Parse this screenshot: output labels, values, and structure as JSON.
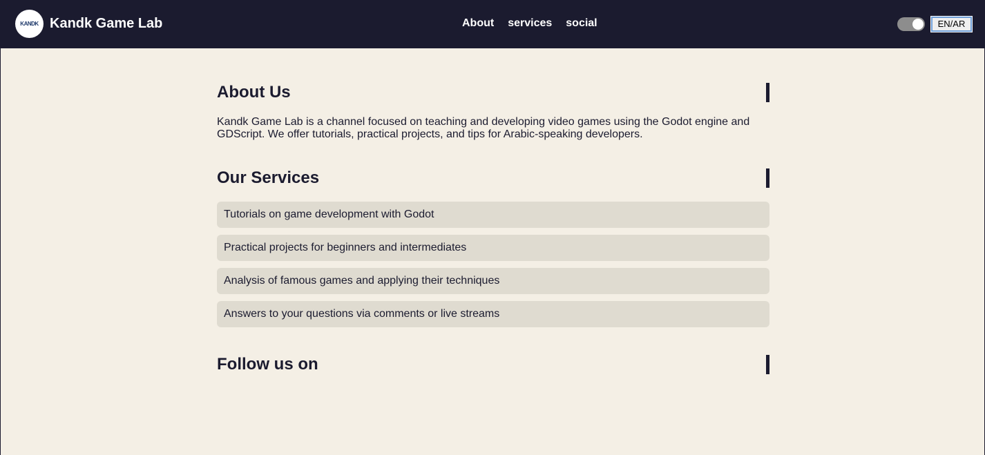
{
  "header": {
    "logo_text": "KANDK",
    "brand": "Kandk Game Lab",
    "nav": [
      "About",
      "services",
      "social"
    ],
    "lang_button": "EN/AR"
  },
  "about": {
    "title": "About Us",
    "text": "Kandk Game Lab is a channel focused on teaching and developing video games using the Godot engine and GDScript. We offer tutorials, practical projects, and tips for Arabic-speaking developers."
  },
  "services": {
    "title": "Our Services",
    "items": [
      "Tutorials on game development with Godot",
      "Practical projects for beginners and intermediates",
      "Analysis of famous games and applying their techniques",
      "Answers to your questions via comments or live streams"
    ]
  },
  "social": {
    "title": "Follow us on"
  },
  "colors": {
    "header_bg": "#1b1b2f",
    "page_bg": "#f4efe5",
    "card_bg": "#dfdbd0"
  }
}
